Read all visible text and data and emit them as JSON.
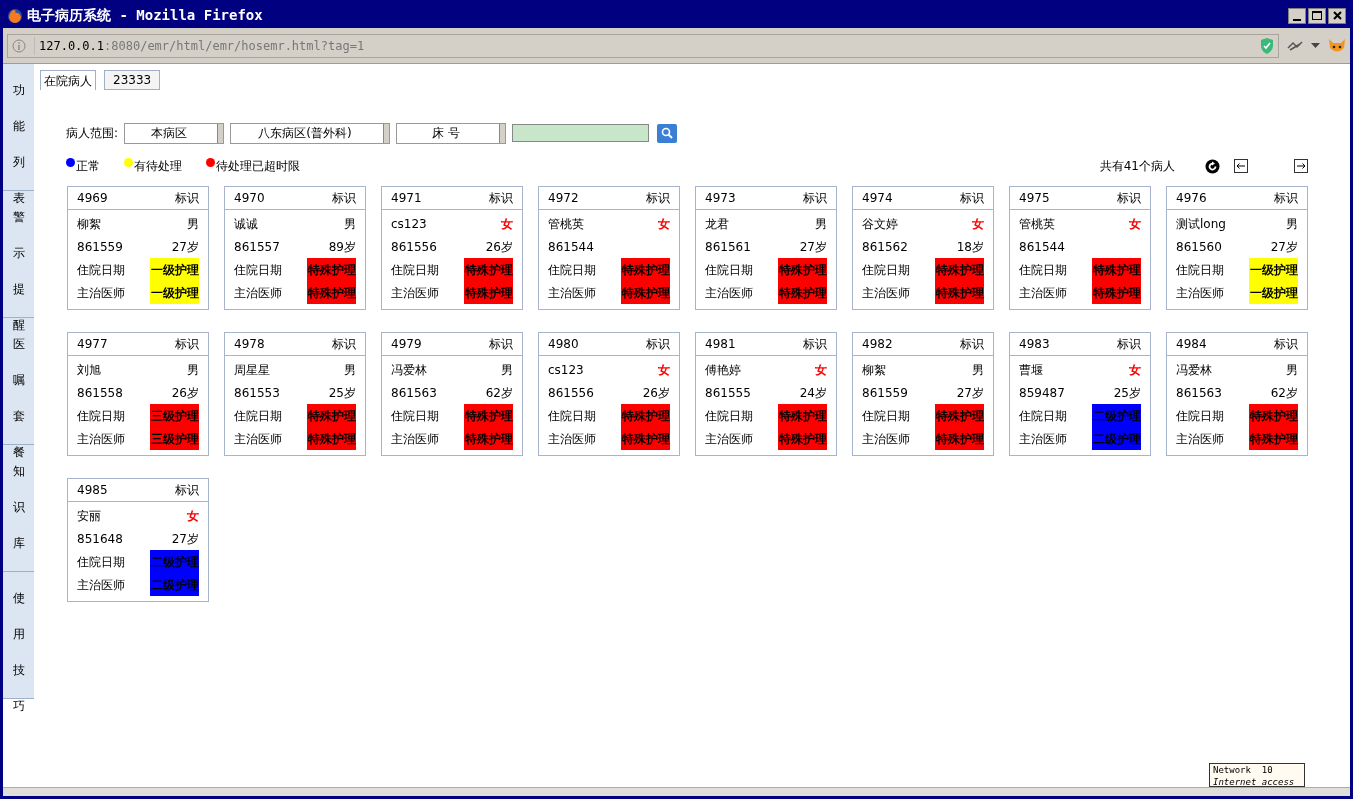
{
  "window": {
    "title": "电子病历系统 - Mozilla Firefox"
  },
  "address": {
    "host": "127.0.0.1",
    "rest": ":8080/emr/html/emr/hosemr.html?tag=1"
  },
  "sidebar": [
    {
      "label": "功能列表"
    },
    {
      "label": "警示提醒"
    },
    {
      "label": "医嘱套餐"
    },
    {
      "label": "知识库"
    },
    {
      "label": "使用技巧"
    }
  ],
  "tabs": [
    {
      "label": "在院病人",
      "selected": true
    },
    {
      "label": "23333",
      "selected": false
    }
  ],
  "filter": {
    "label": "病人范围:",
    "selects": [
      "本病区",
      "八东病区(普外科)",
      "床 号"
    ]
  },
  "legend": [
    {
      "label": "正常",
      "color": "#0000ff"
    },
    {
      "label": "有待处理",
      "color": "#ffff00"
    },
    {
      "label": "待处理已超时限",
      "color": "#ff0000"
    }
  ],
  "total": "共有41个病人",
  "cards": [
    {
      "bed": "4969",
      "tag": "标识",
      "name": "柳絮",
      "sex": "男",
      "kind": "male",
      "mrn": "861559",
      "age": "27岁",
      "rows": [
        {
          "label": "住院日期",
          "care": "一级护理",
          "color": "#ffff00"
        },
        {
          "label": "主治医师",
          "care": "一级护理",
          "color": "#ffff00"
        }
      ]
    },
    {
      "bed": "4970",
      "tag": "标识",
      "name": "诚诚",
      "sex": "男",
      "kind": "male",
      "mrn": "861557",
      "age": "89岁",
      "rows": [
        {
          "label": "住院日期",
          "care": "特殊护理",
          "color": "#ff0000"
        },
        {
          "label": "主治医师",
          "care": "特殊护理",
          "color": "#ff0000"
        }
      ]
    },
    {
      "bed": "4971",
      "tag": "标识",
      "name": "cs123",
      "sex": "女",
      "kind": "female",
      "mrn": "861556",
      "age": "26岁",
      "rows": [
        {
          "label": "住院日期",
          "care": "特殊护理",
          "color": "#ff0000"
        },
        {
          "label": "主治医师",
          "care": "特殊护理",
          "color": "#ff0000"
        }
      ]
    },
    {
      "bed": "4972",
      "tag": "标识",
      "name": "管桃英",
      "sex": "女",
      "kind": "female",
      "mrn": "861544",
      "rows": [
        {
          "label": "住院日期",
          "care": "特殊护理",
          "color": "#ff0000"
        },
        {
          "label": "主治医师",
          "care": "特殊护理",
          "color": "#ff0000"
        }
      ]
    },
    {
      "bed": "4973",
      "tag": "标识",
      "name": "龙君",
      "sex": "男",
      "kind": "male",
      "mrn": "861561",
      "age": "27岁",
      "rows": [
        {
          "label": "住院日期",
          "care": "特殊护理",
          "color": "#ff0000"
        },
        {
          "label": "主治医师",
          "care": "特殊护理",
          "color": "#ff0000"
        }
      ]
    },
    {
      "bed": "4974",
      "tag": "标识",
      "name": "谷文婷",
      "sex": "女",
      "kind": "female",
      "mrn": "861562",
      "age": "18岁",
      "rows": [
        {
          "label": "住院日期",
          "care": "特殊护理",
          "color": "#ff0000"
        },
        {
          "label": "主治医师",
          "care": "特殊护理",
          "color": "#ff0000"
        }
      ]
    },
    {
      "bed": "4975",
      "tag": "标识",
      "name": "管桃英",
      "sex": "女",
      "kind": "female",
      "mrn": "861544",
      "rows": [
        {
          "label": "住院日期",
          "care": "特殊护理",
          "color": "#ff0000"
        },
        {
          "label": "主治医师",
          "care": "特殊护理",
          "color": "#ff0000"
        }
      ]
    },
    {
      "bed": "4976",
      "tag": "标识",
      "name": "测试long",
      "sex": "男",
      "kind": "male",
      "mrn": "861560",
      "age": "27岁",
      "rows": [
        {
          "label": "住院日期",
          "care": "一级护理",
          "color": "#ffff00"
        },
        {
          "label": "主治医师",
          "care": "一级护理",
          "color": "#ffff00"
        }
      ]
    },
    {
      "bed": "4977",
      "tag": "标识",
      "name": "刘旭",
      "sex": "男",
      "kind": "male",
      "mrn": "861558",
      "age": "26岁",
      "rows": [
        {
          "label": "住院日期",
          "care": "三级护理",
          "color": "#ff0000"
        },
        {
          "label": "主治医师",
          "care": "三级护理",
          "color": "#ff0000"
        }
      ]
    },
    {
      "bed": "4978",
      "tag": "标识",
      "name": "周星星",
      "sex": "男",
      "kind": "male",
      "mrn": "861553",
      "age": "25岁",
      "rows": [
        {
          "label": "住院日期",
          "care": "特殊护理",
          "color": "#ff0000"
        },
        {
          "label": "主治医师",
          "care": "特殊护理",
          "color": "#ff0000"
        }
      ]
    },
    {
      "bed": "4979",
      "tag": "标识",
      "name": "冯爱林",
      "sex": "男",
      "kind": "male",
      "mrn": "861563",
      "age": "62岁",
      "rows": [
        {
          "label": "住院日期",
          "care": "特殊护理",
          "color": "#ff0000"
        },
        {
          "label": "主治医师",
          "care": "特殊护理",
          "color": "#ff0000"
        }
      ]
    },
    {
      "bed": "4980",
      "tag": "标识",
      "name": "cs123",
      "sex": "女",
      "kind": "female",
      "mrn": "861556",
      "age": "26岁",
      "rows": [
        {
          "label": "住院日期",
          "care": "特殊护理",
          "color": "#ff0000"
        },
        {
          "label": "主治医师",
          "care": "特殊护理",
          "color": "#ff0000"
        }
      ]
    },
    {
      "bed": "4981",
      "tag": "标识",
      "name": "傅艳婷",
      "sex": "女",
      "kind": "female",
      "mrn": "861555",
      "age": "24岁",
      "rows": [
        {
          "label": "住院日期",
          "care": "特殊护理",
          "color": "#ff0000"
        },
        {
          "label": "主治医师",
          "care": "特殊护理",
          "color": "#ff0000"
        }
      ]
    },
    {
      "bed": "4982",
      "tag": "标识",
      "name": "柳絮",
      "sex": "男",
      "kind": "male",
      "mrn": "861559",
      "age": "27岁",
      "rows": [
        {
          "label": "住院日期",
          "care": "特殊护理",
          "color": "#ff0000"
        },
        {
          "label": "主治医师",
          "care": "特殊护理",
          "color": "#ff0000"
        }
      ]
    },
    {
      "bed": "4983",
      "tag": "标识",
      "name": "曹堰",
      "sex": "女",
      "kind": "female",
      "mrn": "859487",
      "age": "25岁",
      "rows": [
        {
          "label": "住院日期",
          "care": "二级护理",
          "color": "#0000ff"
        },
        {
          "label": "主治医师",
          "care": "二级护理",
          "color": "#0000ff"
        }
      ]
    },
    {
      "bed": "4984",
      "tag": "标识",
      "name": "冯爱林",
      "sex": "男",
      "kind": "male",
      "mrn": "861563",
      "age": "62岁",
      "rows": [
        {
          "label": "住院日期",
          "care": "特殊护理",
          "color": "#ff0000"
        },
        {
          "label": "主治医师",
          "care": "特殊护理",
          "color": "#ff0000"
        }
      ]
    },
    {
      "bed": "4985",
      "tag": "标识",
      "name": "安丽",
      "sex": "女",
      "kind": "female",
      "mrn": "851648",
      "age": "27岁",
      "rows": [
        {
          "label": "住院日期",
          "care": "二级护理",
          "color": "#0000ff"
        },
        {
          "label": "主治医师",
          "care": "二级护理",
          "color": "#0000ff"
        }
      ]
    }
  ],
  "tooltip": {
    "lines": [
      "Network  10",
      "Internet access"
    ]
  }
}
